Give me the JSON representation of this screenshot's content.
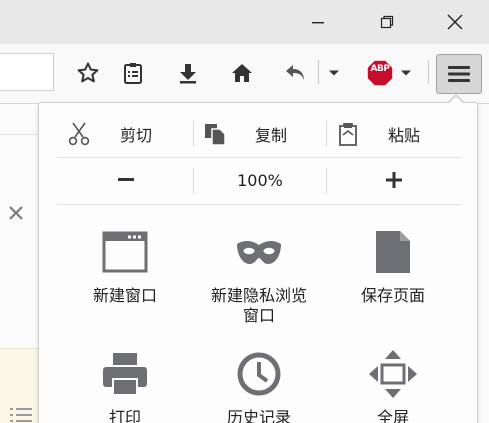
{
  "panel": {
    "edit": {
      "cut": "剪切",
      "copy": "复制",
      "paste": "粘贴"
    },
    "zoom": {
      "out": "−",
      "level": "100%",
      "in": "+"
    },
    "items": [
      {
        "label": "新建窗口",
        "icon": "new-window-icon"
      },
      {
        "label": "新建隐私浏览\n窗口",
        "icon": "private-mask-icon"
      },
      {
        "label": "保存页面",
        "icon": "save-page-icon"
      },
      {
        "label": "打印",
        "icon": "printer-icon"
      },
      {
        "label": "历史记录",
        "icon": "history-clock-icon"
      },
      {
        "label": "全屏",
        "icon": "fullscreen-icon"
      }
    ]
  },
  "toolbar": {
    "adblock_label": "ABP"
  },
  "colors": {
    "icon_gray": "#4a4a4a",
    "grid_icon_gray": "#6d6f73",
    "abp_red": "#c70d2c"
  }
}
